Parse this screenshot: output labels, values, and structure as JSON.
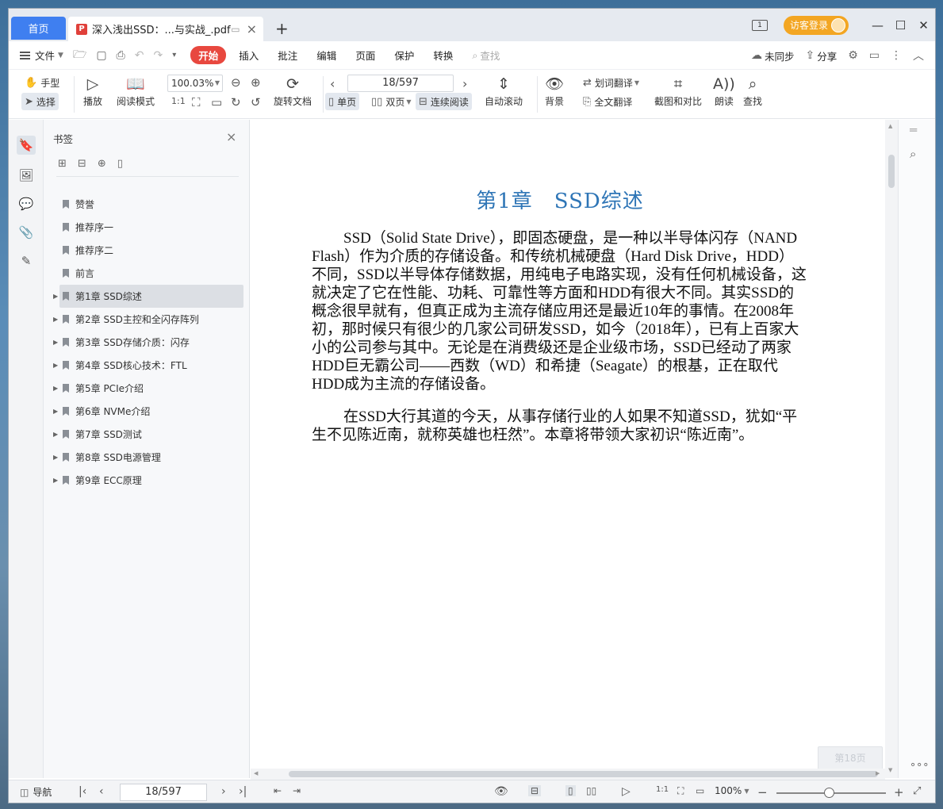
{
  "titlebar": {
    "home_tab": "首页",
    "doc_tab_title": "深入浅出SSD：...与实战_.pdf",
    "new_tab": "+",
    "page_counter_icon": "1",
    "login_label": "访客登录",
    "controls": [
      "—",
      "☐",
      "✕"
    ]
  },
  "menubar": {
    "file": "文件",
    "items": [
      "开始",
      "插入",
      "批注",
      "编辑",
      "页面",
      "保护",
      "转换"
    ],
    "search": "查找",
    "sync": "未同步",
    "share": "分享"
  },
  "toolbar": {
    "hand": "手型",
    "select": "选择",
    "play": "播放",
    "read_mode": "阅读模式",
    "zoom": "100.03%",
    "rotate": "旋转文档",
    "page_display": "18/597",
    "single": "单页",
    "double": "双页",
    "continuous": "连续阅读",
    "auto_scroll": "自动滚动",
    "background": "背景",
    "word_translate": "划词翻译",
    "full_translate": "全文翻译",
    "compare": "截图和对比",
    "read_aloud": "朗读",
    "find": "查找"
  },
  "bookmarks": {
    "header": "书签",
    "items": [
      {
        "label": "赞誉",
        "expandable": false
      },
      {
        "label": "推荐序一",
        "expandable": false
      },
      {
        "label": "推荐序二",
        "expandable": false
      },
      {
        "label": "前言",
        "expandable": false
      },
      {
        "label": "第1章 SSD综述",
        "expandable": true,
        "active": true
      },
      {
        "label": "第2章 SSD主控和全闪存阵列",
        "expandable": true
      },
      {
        "label": "第3章 SSD存储介质：闪存",
        "expandable": true
      },
      {
        "label": "第4章 SSD核心技术：FTL",
        "expandable": true
      },
      {
        "label": "第5章 PCIe介绍",
        "expandable": true
      },
      {
        "label": "第6章 NVMe介绍",
        "expandable": true
      },
      {
        "label": "第7章 SSD测试",
        "expandable": true
      },
      {
        "label": "第8章 SSD电源管理",
        "expandable": true
      },
      {
        "label": "第9章 ECC原理",
        "expandable": true
      }
    ]
  },
  "document": {
    "chapter_title": "第1章　SSD综述",
    "paragraph1": "SSD（Solid State Drive），即固态硬盘，是一种以半导体闪存（NAND Flash）作为介质的存储设备。和传统机械硬盘（Hard Disk Drive，HDD）不同，SSD以半导体存储数据，用纯电子电路实现，没有任何机械设备，这就决定了它在性能、功耗、可靠性等方面和HDD有很大不同。其实SSD的概念很早就有，但真正成为主流存储应用还是最近10年的事情。在2008年初，那时候只有很少的几家公司研发SSD，如今（2018年），已有上百家大小的公司参与其中。无论是在消费级还是企业级市场，SSD已经动了两家HDD巨无霸公司——西数（WD）和希捷（Seagate）的根基，正在取代HDD成为主流的存储设备。",
    "paragraph2": "在SSD大行其道的今天，从事存储行业的人如果不知道SSD，犹如“平生不见陈近南，就称英雄也枉然”。本章将带领大家初识“陈近南”。",
    "page_badge": "第18页"
  },
  "statusbar": {
    "nav": "导航",
    "page": "18/597",
    "zoom": "100%"
  },
  "colors": {
    "accent": "#3f7ff0",
    "start_button": "#e8483f",
    "login_button": "#f3a623",
    "chapter_title": "#2e75b6"
  }
}
